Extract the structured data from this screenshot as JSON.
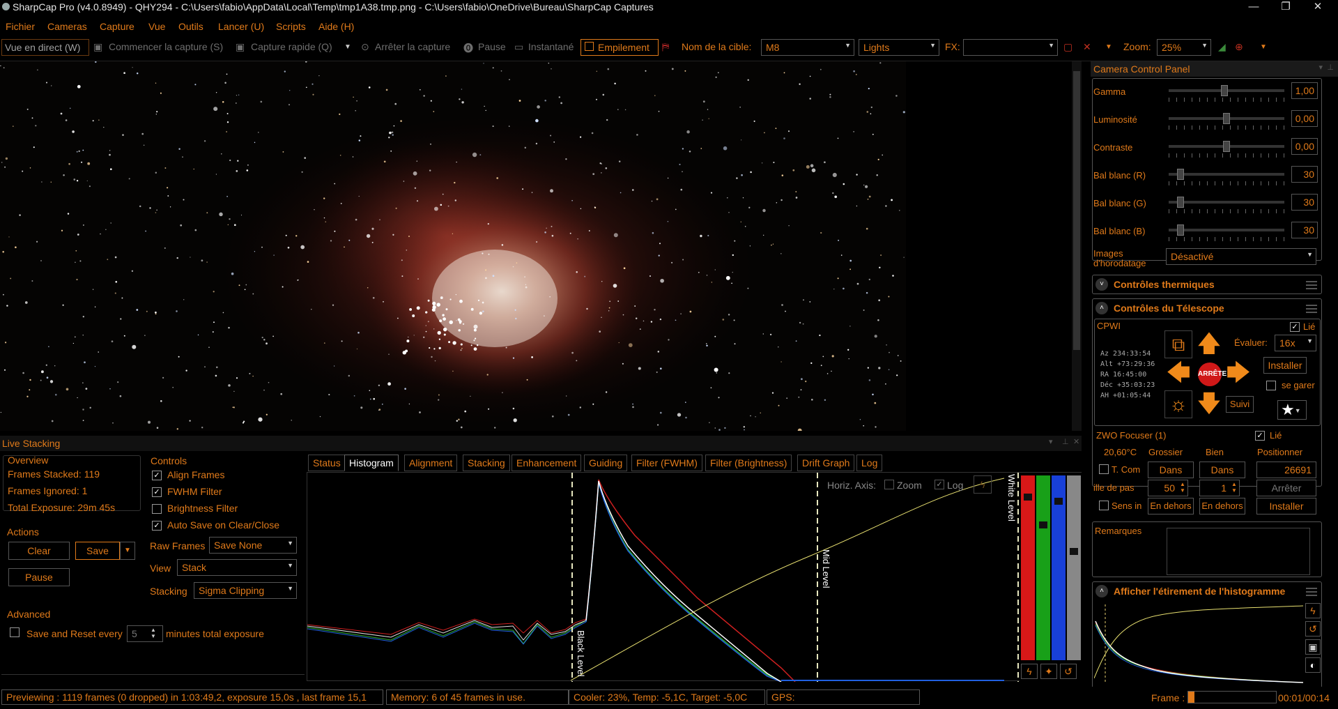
{
  "window": {
    "title": "SharpCap Pro (v4.0.8949) - QHY294 - C:\\Users\\fabio\\AppData\\Local\\Temp\\tmp1A38.tmp.png - C:\\Users\\fabio\\OneDrive\\Bureau\\SharpCap Captures",
    "minimize": "—",
    "restore": "❐",
    "close": "✕"
  },
  "menu": {
    "items": [
      "Fichier",
      "Cameras",
      "Capture",
      "Vue",
      "Outils",
      "Lancer (U)",
      "Scripts",
      "Aide (H)"
    ]
  },
  "toolbar": {
    "live_view": "Vue en direct (W)",
    "start_capture": "Commencer la capture (S)",
    "quick_capture": "Capture rapide (Q)",
    "stop_capture": "Arrêter la capture",
    "pause": "Pause",
    "snapshot": "Instantané",
    "stacking": "Empilement",
    "target_label": "Nom de la cible:",
    "target_value": "M8",
    "frame_type": "Lights",
    "fx_label": "FX:",
    "fx_value": "",
    "zoom_label": "Zoom:",
    "zoom_value": "25%"
  },
  "camera_panel": {
    "title": "Camera Control Panel",
    "controls": [
      {
        "label": "Gamma",
        "value": "1,00",
        "level": 0.48
      },
      {
        "label": "Luminosité",
        "value": "0,00",
        "level": 0.5
      },
      {
        "label": "Contraste",
        "value": "0,00",
        "level": 0.5
      },
      {
        "label": "Bal blanc (R)",
        "value": "30",
        "level": 0.1
      },
      {
        "label": "Bal blanc (G)",
        "value": "30",
        "level": 0.1
      },
      {
        "label": "Bal blanc (B)",
        "value": "30",
        "level": 0.1
      }
    ],
    "timestamp_label_1": "Images",
    "timestamp_label_2": "d'horodatage",
    "timestamp_value": "Désactivé",
    "thermal_title": "Contrôles thermiques",
    "telescope_title": "Contrôles du Télescope",
    "telescope": {
      "name": "CPWI",
      "linked": "Lié",
      "rate_label": "Évaluer:",
      "rate_value": "16x",
      "install": "Installer",
      "park": "se garer",
      "stop": "ARRÊTE",
      "track": "Suivi",
      "coords": [
        "Az  234:33:54",
        "Alt +73:29:36",
        "RA   16:45:00",
        "Déc +35:03:23",
        "AH  +01:05:44"
      ]
    },
    "focuser": {
      "title": "ZWO Focuser (1)",
      "linked": "Lié",
      "temp": "20,60°C",
      "coarse": "Grossier",
      "fine": "Bien",
      "position_label": "Positionner",
      "tcomp": "T. Com",
      "in": "Dans",
      "position_value": "26691",
      "step_label": "ille de pas",
      "step_coarse": "50",
      "step_fine": "1",
      "stop": "Arrêter",
      "reverse": "Sens in",
      "out": "En dehors",
      "install": "Installer"
    },
    "notes_label": "Remarques",
    "histogram_title": "Afficher l'étirement de l'histogramme"
  },
  "live_stacking": {
    "title": "Live Stacking",
    "overview": {
      "title": "Overview",
      "frames_stacked": "Frames Stacked:  119",
      "frames_ignored": "Frames Ignored:  1",
      "total_exposure": "Total Exposure:   29m 45s"
    },
    "actions": {
      "title": "Actions",
      "clear": "Clear",
      "save": "Save",
      "pause": "Pause"
    },
    "controls": {
      "title": "Controls",
      "align": "Align Frames",
      "fwhm": "FWHM Filter",
      "brightness": "Brightness Filter",
      "autosave": "Auto Save on Clear/Close",
      "raw_label": "Raw Frames",
      "raw_value": "Save None",
      "view_label": "View",
      "view_value": "Stack",
      "stacking_label": "Stacking",
      "stacking_value": "Sigma Clipping"
    },
    "advanced": {
      "title": "Advanced",
      "save_reset": "Save and Reset every",
      "minutes": "5",
      "suffix": "minutes total exposure"
    },
    "tabs": [
      "Status",
      "Histogram",
      "Alignment",
      "Stacking",
      "Enhancement",
      "Guiding",
      "Filter (FWHM)",
      "Filter (Brightness)",
      "Drift Graph",
      "Log"
    ],
    "histogram": {
      "axis_label": "Horiz. Axis:",
      "zoom": "Zoom",
      "log": "Log",
      "black_level": "Black Level",
      "mid_level": "Mid Level",
      "white_level": "White Level"
    }
  },
  "status": {
    "preview": "Previewing : 1119 frames (0 dropped) in 1:03:49,2, exposure 15,0s , last frame 15,1",
    "memory": "Memory: 6 of 45 frames in use.",
    "cooler": "Cooler: 23%, Temp: -5,1C, Target: -5,0C",
    "gps": "GPS:",
    "frame_label": "Frame :",
    "frame_time": "00:01/00:14"
  },
  "colors": {
    "accent": "#e07a1a",
    "background": "#000000",
    "nebula": "#b0473a"
  }
}
